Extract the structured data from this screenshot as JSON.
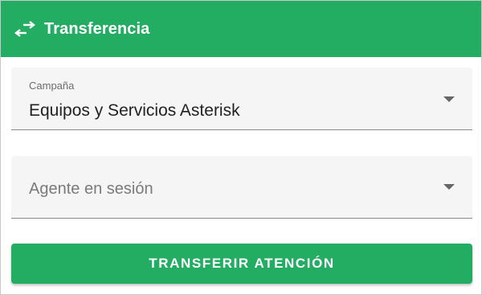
{
  "header": {
    "title": "Transferencia",
    "icon": "swap-horiz-icon"
  },
  "campaign_field": {
    "label": "Campaña",
    "value": "Equipos y Servicios Asterisk",
    "icon": "arrow-drop-down-icon"
  },
  "agent_field": {
    "placeholder": "Agente en sesión",
    "value": "",
    "icon": "arrow-drop-down-icon"
  },
  "actions": {
    "transfer_label": "TRANSFERIR ATENCIÓN"
  },
  "colors": {
    "accent": "#22ad62",
    "field_background": "#f5f5f5",
    "text": "#222222"
  }
}
